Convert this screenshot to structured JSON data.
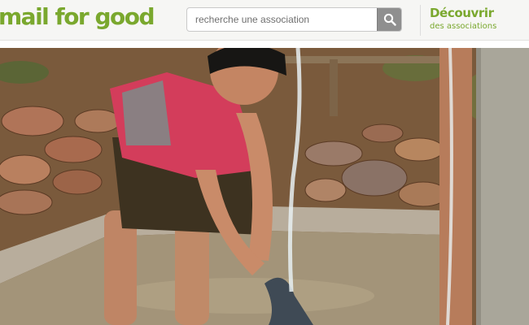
{
  "header": {
    "logo_text": "mail for good",
    "search": {
      "placeholder": "recherche une association",
      "button_icon": "search-icon"
    },
    "discover": {
      "title": "Découvrir",
      "subtitle": "des associations"
    }
  },
  "hero": {
    "image_icon": "child-washing-hands-photo",
    "colors": {
      "brand": "#7aa82e",
      "search_button": "#8f8f8f",
      "header_bg": "#f6f6f4"
    }
  }
}
